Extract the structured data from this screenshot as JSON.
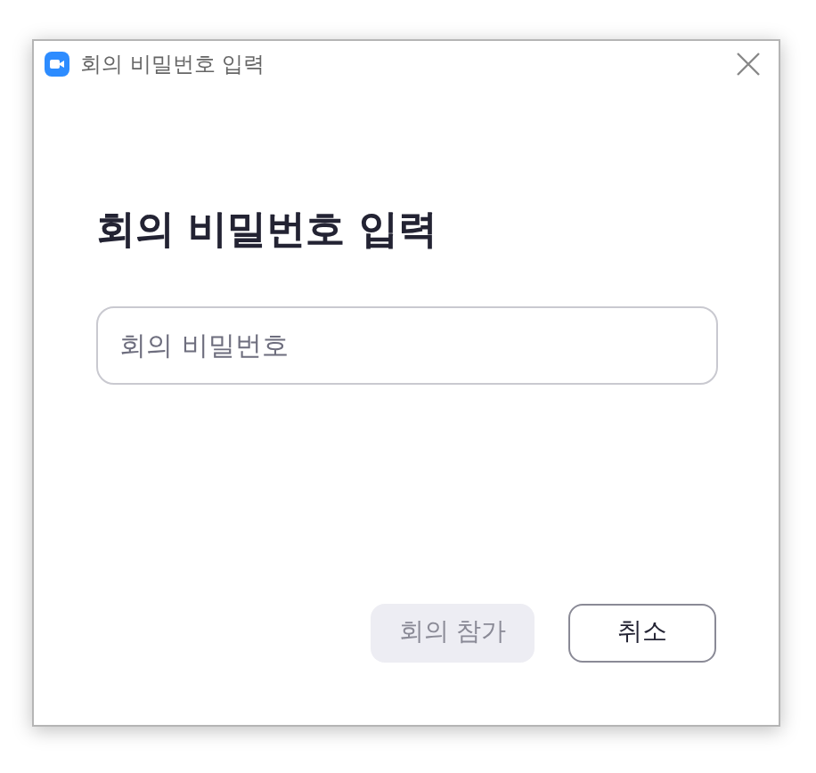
{
  "window": {
    "title": "회의 비밀번호 입력"
  },
  "heading": "회의 비밀번호 입력",
  "password_field": {
    "placeholder": "회의 비밀번호"
  },
  "buttons": [
    {
      "kind": "primary",
      "label": "회의 참가",
      "disabled": true
    },
    {
      "kind": "secondary",
      "label": "취소",
      "disabled": false
    }
  ]
}
